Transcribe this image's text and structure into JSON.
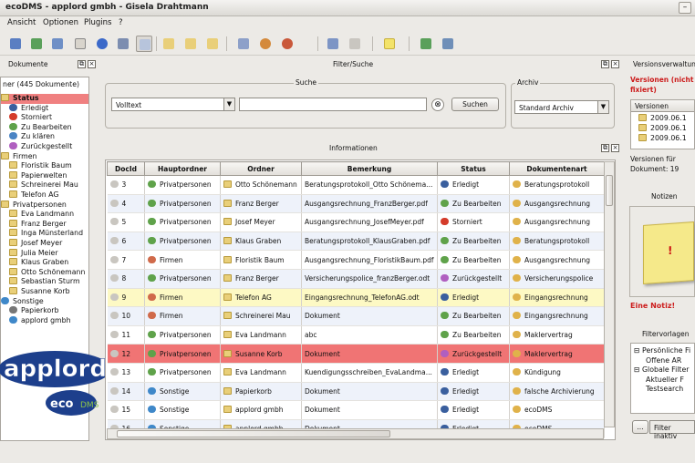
{
  "window": {
    "title": "ecoDMS - applord gmbh - Gisela Drahtmann"
  },
  "menu": [
    "Ansicht",
    "Optionen",
    "Plugins",
    "?"
  ],
  "docks": {
    "dokumente": "Dokumente",
    "filter": "Filter/Suche",
    "versions": "Versionsverwaltung",
    "informationen": "Informationen",
    "notizen": "Notizen",
    "filtervorlagen": "Filtervorlagen"
  },
  "tree": {
    "header": "ner (445 Dokumente)",
    "items": [
      {
        "label": "Status",
        "level": 1,
        "icon": "folder-icon",
        "selected": true
      },
      {
        "label": "Erledigt",
        "level": 2,
        "icon": "done-icon"
      },
      {
        "label": "Storniert",
        "level": 2,
        "icon": "cancel-icon"
      },
      {
        "label": "Zu Bearbeiten",
        "level": 2,
        "icon": "work-icon"
      },
      {
        "label": "Zu klären",
        "level": 2,
        "icon": "question-icon"
      },
      {
        "label": "Zurückgestellt",
        "level": 2,
        "icon": "deferred-icon"
      },
      {
        "label": "Firmen",
        "level": 1,
        "icon": "folder-icon"
      },
      {
        "label": "Floristik Baum",
        "level": 2,
        "icon": "folder-icon"
      },
      {
        "label": "Papierwelten",
        "level": 2,
        "icon": "folder-icon"
      },
      {
        "label": "Schreinerei Mau",
        "level": 2,
        "icon": "folder-icon"
      },
      {
        "label": "Telefon AG",
        "level": 2,
        "icon": "folder-icon"
      },
      {
        "label": "Privatpersonen",
        "level": 1,
        "icon": "folder-icon"
      },
      {
        "label": "Eva Landmann",
        "level": 2,
        "icon": "folder-icon"
      },
      {
        "label": "Franz Berger",
        "level": 2,
        "icon": "folder-icon"
      },
      {
        "label": "Inga Münsterland",
        "level": 2,
        "icon": "folder-icon"
      },
      {
        "label": "Josef Meyer",
        "level": 2,
        "icon": "folder-icon"
      },
      {
        "label": "Julia Meier",
        "level": 2,
        "icon": "folder-icon"
      },
      {
        "label": "Klaus Graben",
        "level": 2,
        "icon": "folder-icon"
      },
      {
        "label": "Otto Schönemann",
        "level": 2,
        "icon": "folder-icon"
      },
      {
        "label": "Sebastian Sturm",
        "level": 2,
        "icon": "folder-icon"
      },
      {
        "label": "Susanne Korb",
        "level": 2,
        "icon": "folder-icon"
      },
      {
        "label": "Sonstige",
        "level": 1,
        "icon": "globe-icon"
      },
      {
        "label": "Papierkorb",
        "level": 2,
        "icon": "trash-icon"
      },
      {
        "label": "applord gmbh",
        "level": 2,
        "icon": "globe-icon"
      }
    ]
  },
  "search": {
    "group_label": "Suche",
    "mode": "Volltext",
    "query": "",
    "button": "Suchen"
  },
  "archive": {
    "group_label": "Archiv",
    "value": "Standard Archiv"
  },
  "table": {
    "columns": [
      "DocId",
      "Hauptordner",
      "Ordner",
      "Bemerkung",
      "Status",
      "Dokumentenart"
    ],
    "rows": [
      {
        "id": "3",
        "haupt": "Privatpersonen",
        "ordner": "Otto Schönemann",
        "bem": "Beratungsprotokoll_Otto Schönema...",
        "status": "Erledigt",
        "art": "Beratungsprotokoll",
        "style": ""
      },
      {
        "id": "4",
        "haupt": "Privatpersonen",
        "ordner": "Franz Berger",
        "bem": "Ausgangsrechnung_FranzBerger.pdf",
        "status": "Zu Bearbeiten",
        "art": "Ausgangsrechnung",
        "style": "alt"
      },
      {
        "id": "5",
        "haupt": "Privatpersonen",
        "ordner": "Josef Meyer",
        "bem": "Ausgangsrechnung_JosefMeyer.pdf",
        "status": "Storniert",
        "art": "Ausgangsrechnung",
        "style": ""
      },
      {
        "id": "6",
        "haupt": "Privatpersonen",
        "ordner": "Klaus Graben",
        "bem": "Beratungsprotokoll_KlausGraben.pdf",
        "status": "Zu Bearbeiten",
        "art": "Beratungsprotokoll",
        "style": "alt"
      },
      {
        "id": "7",
        "haupt": "Firmen",
        "ordner": "Floristik Baum",
        "bem": "Ausgangsrechnung_FloristikBaum.pdf",
        "status": "Zu Bearbeiten",
        "art": "Ausgangsrechnung",
        "style": ""
      },
      {
        "id": "8",
        "haupt": "Privatpersonen",
        "ordner": "Franz Berger",
        "bem": "Versicherungspolice_franzBerger.odt",
        "status": "Zurückgestellt",
        "art": "Versicherungspolice",
        "style": "alt"
      },
      {
        "id": "9",
        "haupt": "Firmen",
        "ordner": "Telefon AG",
        "bem": "Eingangsrechnung_TelefonAG.odt",
        "status": "Erledigt",
        "art": "Eingangsrechnung",
        "style": "yel"
      },
      {
        "id": "10",
        "haupt": "Firmen",
        "ordner": "Schreinerei Mau",
        "bem": "Dokument",
        "status": "Zu Bearbeiten",
        "art": "Eingangsrechnung",
        "style": "alt"
      },
      {
        "id": "11",
        "haupt": "Privatpersonen",
        "ordner": "Eva Landmann",
        "bem": "abc",
        "status": "Zu Bearbeiten",
        "art": "Maklervertrag",
        "style": ""
      },
      {
        "id": "12",
        "haupt": "Privatpersonen",
        "ordner": "Susanne Korb",
        "bem": "Dokument",
        "status": "Zurückgestellt",
        "art": "Maklervertrag",
        "style": "sel"
      },
      {
        "id": "13",
        "haupt": "Privatpersonen",
        "ordner": "Eva Landmann",
        "bem": "Kuendigungsschreiben_EvaLandma...",
        "status": "Erledigt",
        "art": "Kündigung",
        "style": ""
      },
      {
        "id": "14",
        "haupt": "Sonstige",
        "ordner": "Papierkorb",
        "bem": "Dokument",
        "status": "Erledigt",
        "art": "falsche Archivierung",
        "style": "alt"
      },
      {
        "id": "15",
        "haupt": "Sonstige",
        "ordner": "applord gmbh",
        "bem": "Dokument",
        "status": "Erledigt",
        "art": "ecoDMS",
        "style": ""
      },
      {
        "id": "16",
        "haupt": "Sonstige",
        "ordner": "applord gmbh",
        "bem": "Dokument",
        "status": "Erledigt",
        "art": "ecoDMS",
        "style": "alt"
      }
    ]
  },
  "versions": {
    "title": "Versionen (nicht fixiert)",
    "col": "Versionen",
    "items": [
      "2009.06.1",
      "2009.06.1",
      "2009.06.1"
    ],
    "info": "Versionen für Dokument: 19"
  },
  "notiz": {
    "text": "Eine Notiz!",
    "mark": "!"
  },
  "filtervorlagen": {
    "items": [
      "Persönliche Fi",
      "Offene AR",
      "Globale Filter",
      "Aktueller F",
      "Testsearch"
    ],
    "button": "...",
    "field": "Filter inaktiv"
  },
  "logo": {
    "brand": "applord",
    "product": "ecoDMS"
  }
}
